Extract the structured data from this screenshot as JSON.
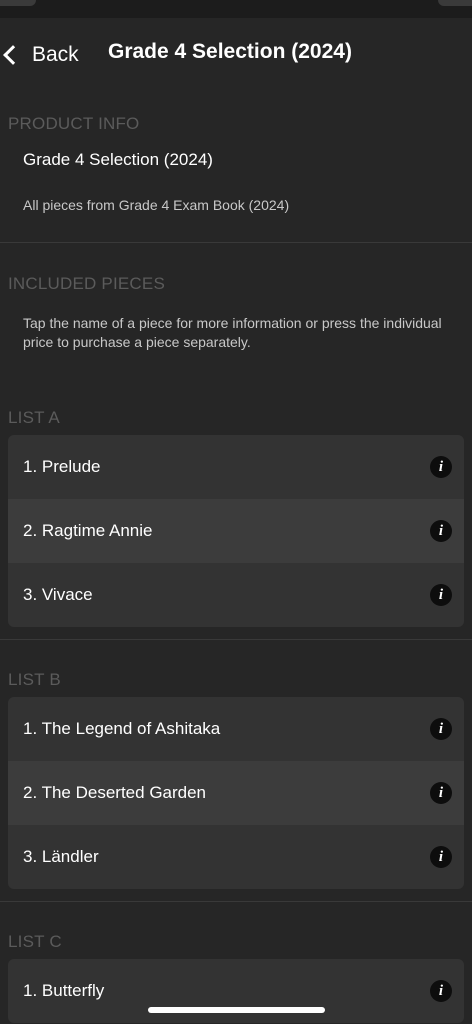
{
  "nav": {
    "back_label": "Back",
    "title": "Grade 4 Selection (2024)"
  },
  "product_info": {
    "heading": "PRODUCT INFO",
    "title": "Grade 4 Selection (2024)",
    "description": "All pieces from Grade 4 Exam Book (2024)"
  },
  "included": {
    "heading": "INCLUDED PIECES",
    "description": "Tap the name of a piece for more information or press the individual price to purchase a piece separately."
  },
  "lists": [
    {
      "heading": "LIST A",
      "items": [
        {
          "title": "1. Prelude"
        },
        {
          "title": "2. Ragtime Annie"
        },
        {
          "title": "3. Vivace"
        }
      ]
    },
    {
      "heading": "LIST B",
      "items": [
        {
          "title": "1. The Legend of Ashitaka"
        },
        {
          "title": "2. The Deserted Garden"
        },
        {
          "title": "3. Ländler"
        }
      ]
    },
    {
      "heading": "LIST C",
      "items": [
        {
          "title": "1. Butterfly"
        }
      ]
    }
  ],
  "icons": {
    "info": "info-icon",
    "back": "chevron-left-icon"
  },
  "colors": {
    "background": "#262626",
    "row": "#333333",
    "row_alt": "#3c3c3c",
    "section_heading": "#5b5b5b"
  }
}
